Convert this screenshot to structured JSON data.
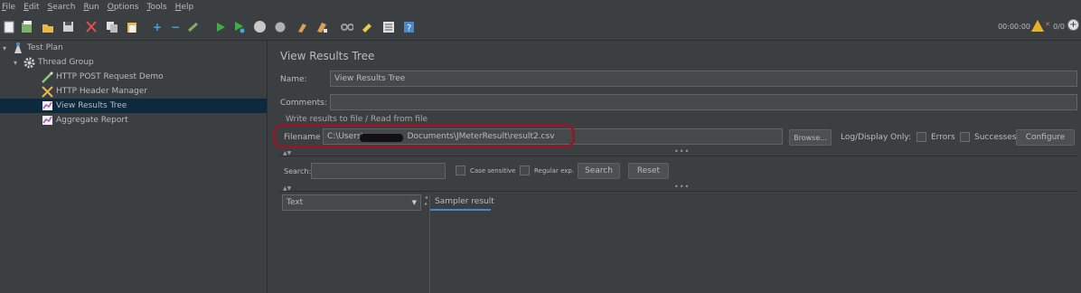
{
  "menu": {
    "items": [
      {
        "ul": "F",
        "rest": "ile"
      },
      {
        "ul": "E",
        "rest": "dit"
      },
      {
        "ul": "S",
        "rest": "earch"
      },
      {
        "ul": "R",
        "rest": "un"
      },
      {
        "ul": "O",
        "rest": "ptions"
      },
      {
        "ul": "T",
        "rest": "ools"
      },
      {
        "ul": "H",
        "rest": "elp"
      }
    ]
  },
  "toolbar": {
    "timer": "00:00:00",
    "thread_count": "0/0",
    "icons": [
      "new-icon",
      "templates-icon",
      "open-icon",
      "save-icon",
      "cut-icon",
      "copy-icon",
      "paste-icon",
      "expand-icon",
      "collapse-icon",
      "toggle-icon",
      "start-icon",
      "start-no-pause-icon",
      "stop-icon",
      "shutdown-icon",
      "clear-icon",
      "clear-all-icon",
      "search-icon",
      "reset-search-icon",
      "function-helper-icon",
      "help-icon"
    ],
    "colors": {
      "warning": "#e6b422",
      "start": "#3cb043"
    }
  },
  "tree": {
    "items": [
      {
        "label": "Test Plan",
        "icon": "test-plan-icon",
        "level": 0,
        "twisty": "▾",
        "selected": false
      },
      {
        "label": "Thread Group",
        "icon": "gear-icon",
        "level": 1,
        "twisty": "▾",
        "selected": false
      },
      {
        "label": "HTTP POST Request Demo",
        "icon": "pipette-icon",
        "level": 2,
        "twisty": "",
        "selected": false
      },
      {
        "label": "HTTP Header Manager",
        "icon": "tools-icon",
        "level": 2,
        "twisty": "",
        "selected": false
      },
      {
        "label": "View Results Tree",
        "icon": "chart-icon",
        "level": 2,
        "twisty": "",
        "selected": true
      },
      {
        "label": "Aggregate Report",
        "icon": "chart-icon",
        "level": 2,
        "twisty": "",
        "selected": false
      }
    ]
  },
  "panel": {
    "title": "View Results Tree",
    "name_label": "Name:",
    "name_value": "View Results Tree",
    "comments_label": "Comments:",
    "comments_value": "",
    "file_group_title": "Write results to file / Read from file",
    "filename_label": "Filename",
    "filename_prefix": "C:\\Users\\",
    "filename_suffix": "Documents\\JMeterResult\\result2.csv",
    "browse_label": "Browse...",
    "log_display_label": "Log/Display Only:",
    "errors_label": "Errors",
    "successes_label": "Successes",
    "configure_label": "Configure",
    "search_label": "Search:",
    "search_value": "",
    "case_sensitive_label": "Case sensitive",
    "regular_exp_label": "Regular exp.",
    "search_button_label": "Search",
    "reset_button_label": "Reset",
    "renderer_value": "Text",
    "tab_label": "Sampler result",
    "accent_color": "#4a88c7",
    "highlight_color": "#8b1c2c"
  }
}
